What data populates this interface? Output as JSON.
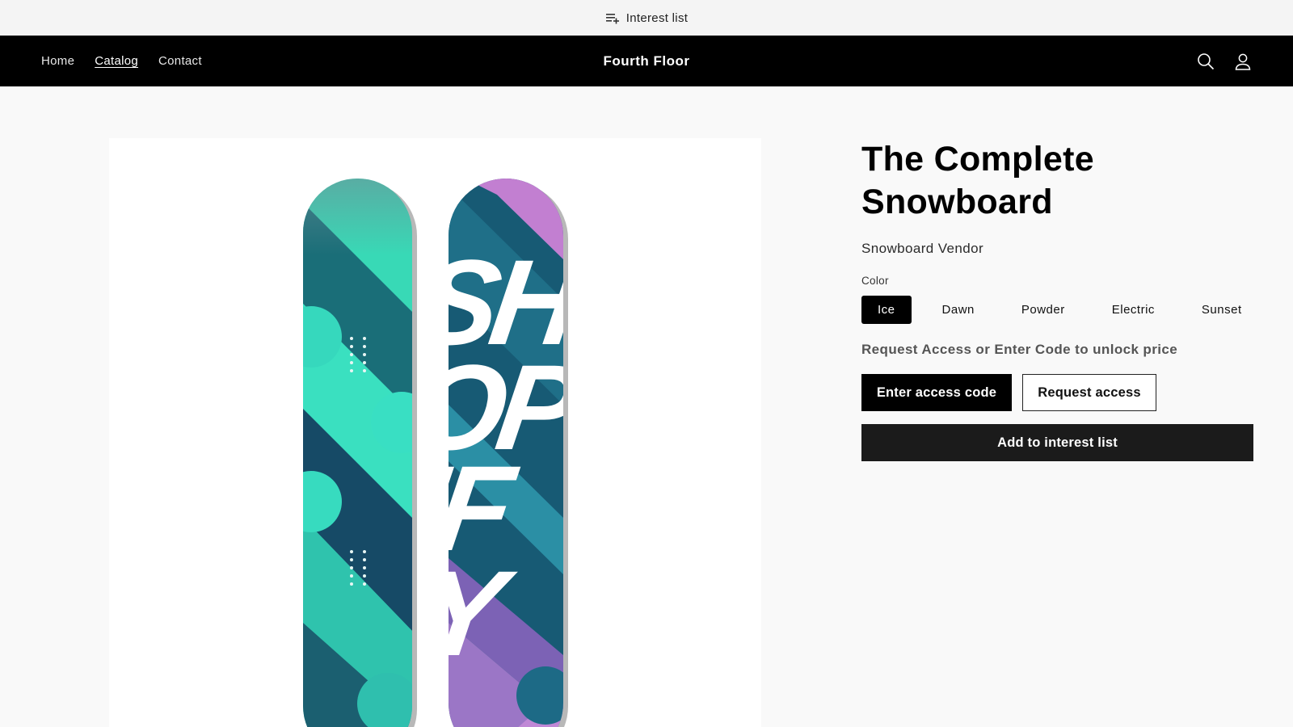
{
  "announcement": {
    "label": "Interest list",
    "icon": "playlist-add-icon"
  },
  "header": {
    "nav": [
      {
        "label": "Home",
        "active": false
      },
      {
        "label": "Catalog",
        "active": true
      },
      {
        "label": "Contact",
        "active": false
      }
    ],
    "brand": "Fourth Floor",
    "icons": [
      "search-icon",
      "account-icon"
    ]
  },
  "product": {
    "title_line1": "The Complete",
    "title_line2": "Snowboard",
    "vendor": "Snowboard Vendor",
    "option_label": "Color",
    "colors": [
      "Ice",
      "Dawn",
      "Powder",
      "Electric",
      "Sunset"
    ],
    "selected_color": "Ice",
    "unlock_text": "Request Access or Enter Code to unlock price",
    "enter_code_label": "Enter access code",
    "request_access_label": "Request access",
    "interest_label": "Add to interest list",
    "image_text": "SHOPIFY"
  },
  "colors": {
    "header_bg": "#000000",
    "board_teal": "#3ce0bd",
    "board_dark": "#123e53",
    "board_purple": "#b97fd3"
  }
}
